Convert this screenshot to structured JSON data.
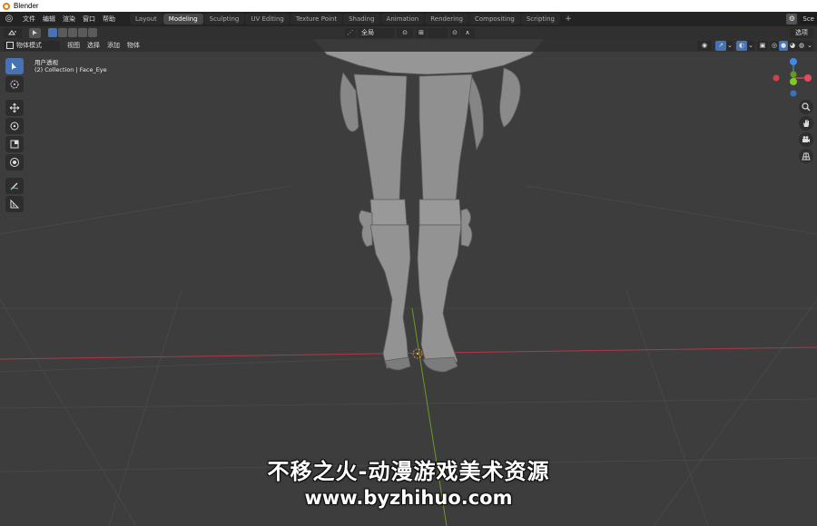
{
  "os_title": "Blender",
  "menu": [
    "文件",
    "编辑",
    "渲染",
    "窗口",
    "帮助"
  ],
  "workspaces": [
    "Layout",
    "Modeling",
    "Sculpting",
    "UV Editing",
    "Texture Point",
    "Shading",
    "Animation",
    "Rendering",
    "Compositing",
    "Scripting"
  ],
  "active_workspace": "Modeling",
  "scene_name": "Sce",
  "tool_header": {
    "transform_orientation": "全局",
    "options_label": "选项"
  },
  "view_header": {
    "mode": "物体模式",
    "menus": [
      "视图",
      "选择",
      "添加",
      "物体"
    ]
  },
  "viewport": {
    "view_name": "用户透视",
    "collection_info": "(2) Collection | Face_Eye"
  },
  "toolbar_icons": [
    "select-box-icon",
    "cursor-icon",
    "move-icon",
    "rotate-icon",
    "scale-icon",
    "transform-icon",
    "annotate-icon",
    "measure-icon"
  ],
  "nav_icons": [
    "zoom-icon",
    "pan-hand-icon",
    "camera-icon",
    "grid-icon"
  ],
  "gizmo_axes": {
    "x": "#e84a5a",
    "y": "#7ec927",
    "z": "#3f8ae6"
  },
  "watermark": {
    "line1": "不移之火-动漫游戏美术资源",
    "line2": "www.byzhihuo.com"
  }
}
